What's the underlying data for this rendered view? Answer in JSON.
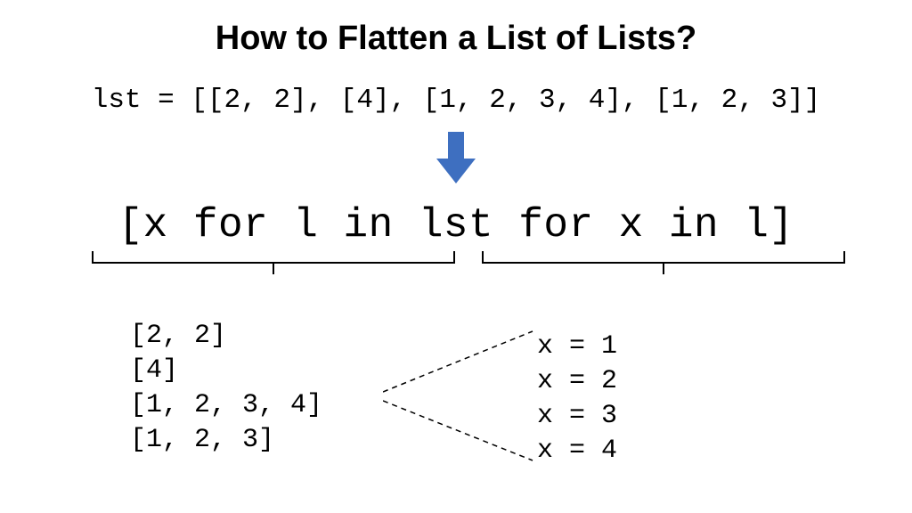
{
  "title": "How to Flatten a List of Lists?",
  "code_top": "lst = [[2, 2], [4], [1, 2, 3, 4], [1, 2, 3]]",
  "code_main": "[x for l in lst for x in l]",
  "sublists": [
    "[2, 2]",
    "[4]",
    "[1, 2, 3, 4]",
    "[1, 2, 3]"
  ],
  "x_values": [
    "x = 1",
    "x = 2",
    "x = 3",
    "x = 4"
  ],
  "colors": {
    "arrow": "#3e6fc0"
  }
}
